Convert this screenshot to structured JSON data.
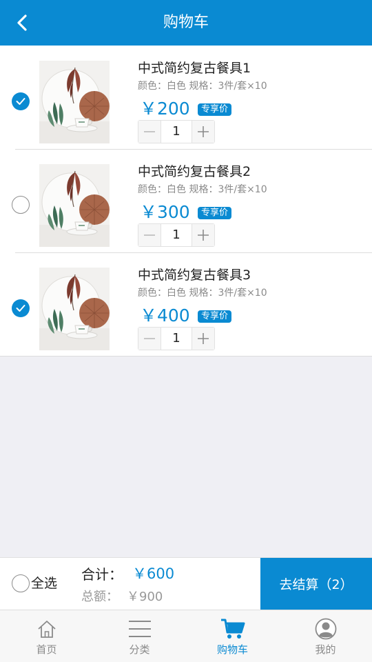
{
  "header": {
    "title": "购物车"
  },
  "colors": {
    "accent": "#0a8ad2",
    "background": "#efeff4"
  },
  "items": [
    {
      "name": "中式简约复古餐具1",
      "spec": "颜色：白色 规格：3件/套×10",
      "price": "￥200",
      "badge": "专享价",
      "qty": "1",
      "checked": true
    },
    {
      "name": "中式简约复古餐具2",
      "spec": "颜色：白色 规格：3件/套×10",
      "price": "￥300",
      "badge": "专享价",
      "qty": "1",
      "checked": false
    },
    {
      "name": "中式简约复古餐具3",
      "spec": "颜色：白色 规格：3件/套×10",
      "price": "￥400",
      "badge": "专享价",
      "qty": "1",
      "checked": true
    }
  ],
  "footer": {
    "select_all": "全选",
    "total_label": "合计：",
    "total_value": "￥600",
    "sum_label": "总额：",
    "sum_value": "￥900",
    "checkout": "去结算（2）"
  },
  "tabs": [
    {
      "label": "首页",
      "icon": "home-icon"
    },
    {
      "label": "分类",
      "icon": "menu-icon"
    },
    {
      "label": "购物车",
      "icon": "cart-icon",
      "active": true
    },
    {
      "label": "我的",
      "icon": "user-icon"
    }
  ]
}
